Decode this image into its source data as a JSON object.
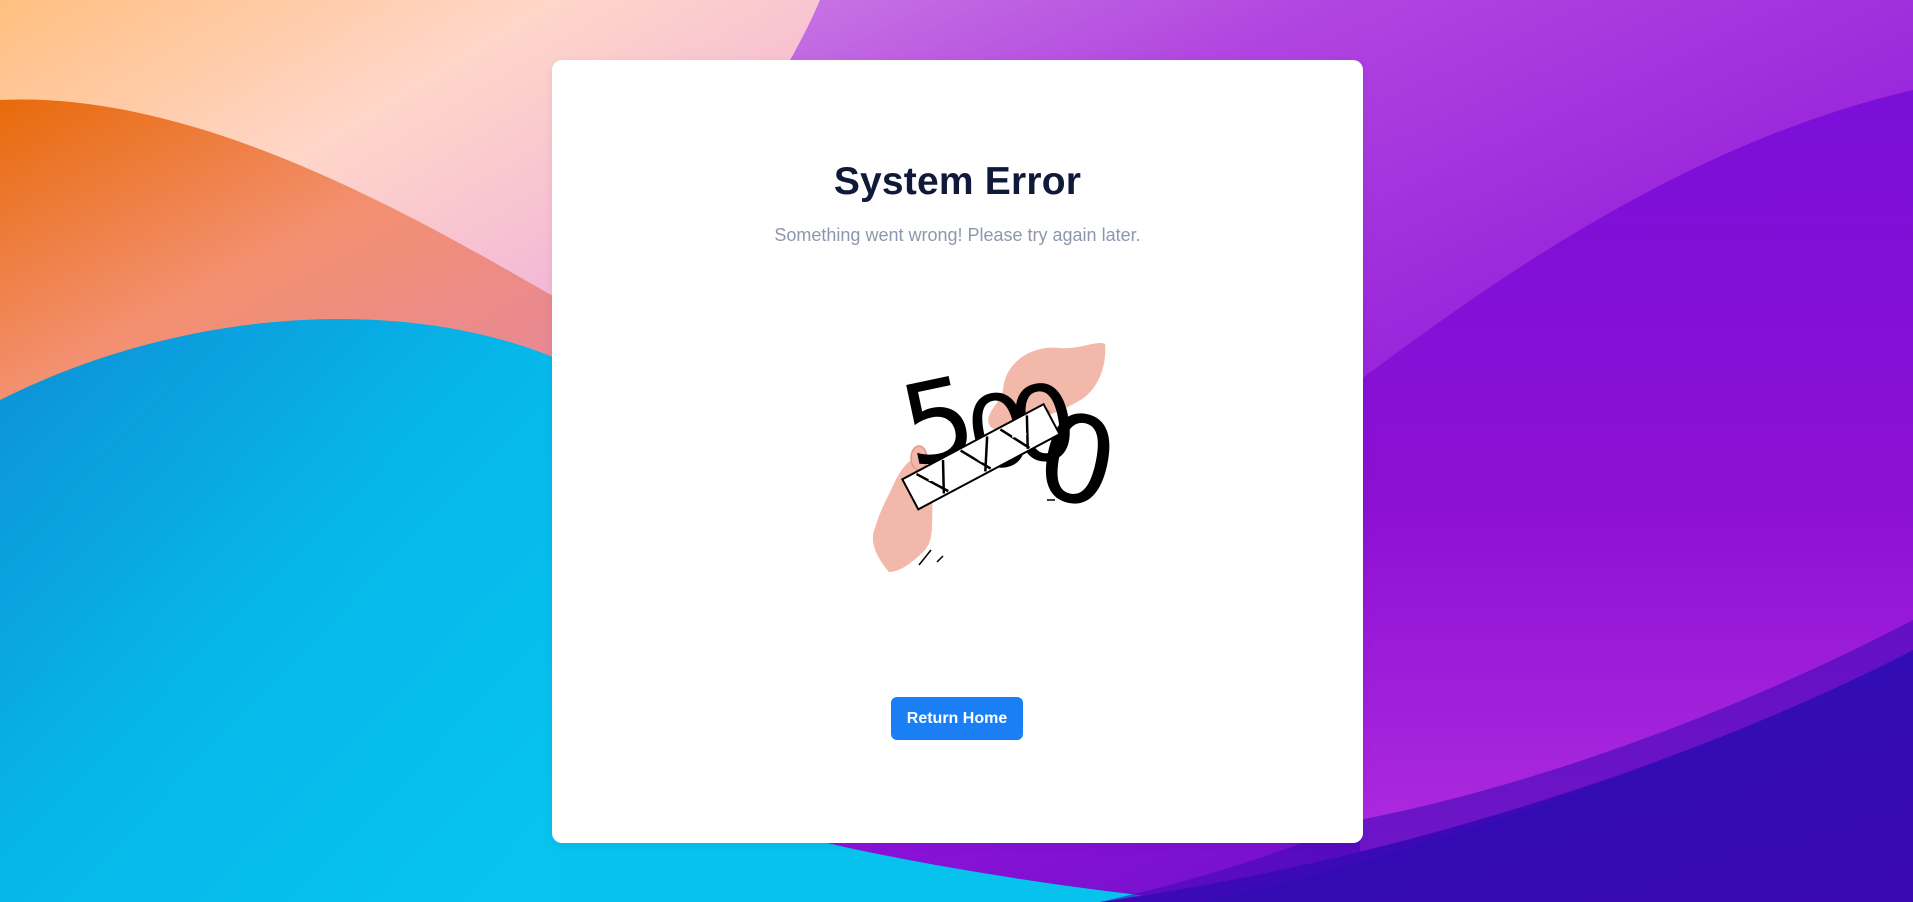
{
  "error_page": {
    "title": "System Error",
    "message": "Something went wrong! Please try again later.",
    "illustration_icon": "broken-500-illustration",
    "illustration_digits": [
      "5",
      "0",
      "0",
      "0"
    ],
    "return_home_label": "Return Home"
  },
  "colors": {
    "title": "#0f1a3a",
    "message": "#8e96ad",
    "button": "#1a7ff5",
    "hand": "#f2b8aa"
  }
}
